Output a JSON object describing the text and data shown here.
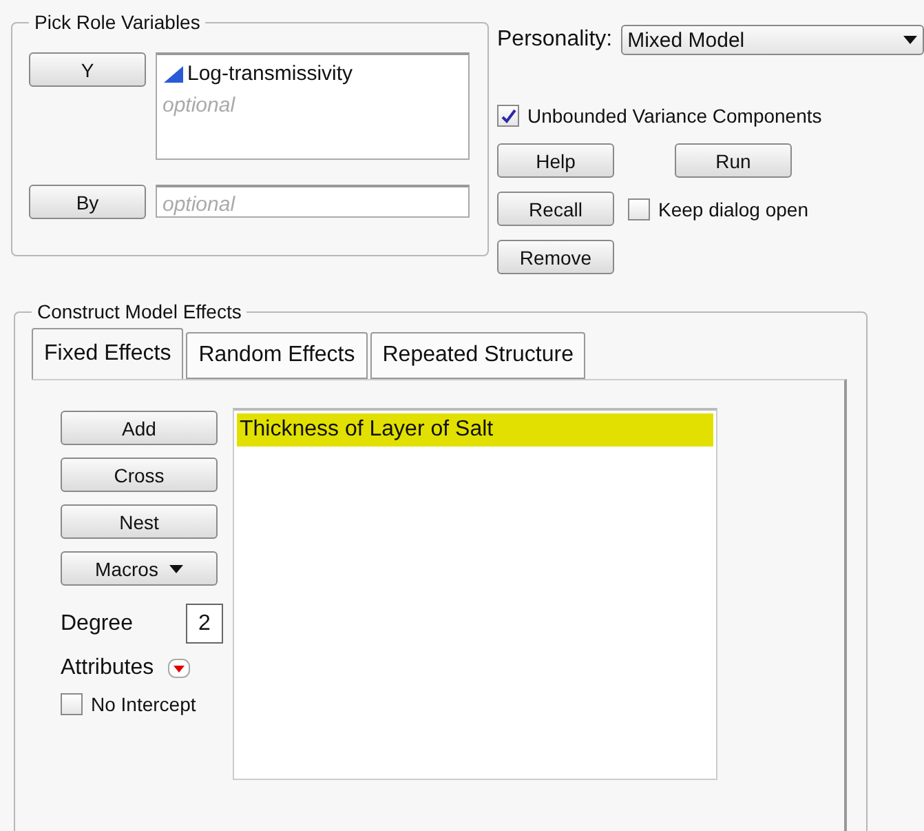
{
  "role_panel": {
    "title": "Pick Role Variables",
    "roles": [
      {
        "button": "Y",
        "items": [
          {
            "kind": "variable",
            "text": "Log-transmissivity"
          },
          {
            "kind": "hint",
            "text": "optional"
          }
        ]
      },
      {
        "button": "By",
        "items": [
          {
            "kind": "hint",
            "text": "optional"
          }
        ]
      }
    ]
  },
  "personality": {
    "label": "Personality:",
    "value": "Mixed Model"
  },
  "unbounded": {
    "label": "Unbounded Variance Components",
    "checked": true
  },
  "help_button": "Help",
  "run_button": "Run",
  "recall_button": "Recall",
  "remove_button": "Remove",
  "keep_open": {
    "label": "Keep dialog open",
    "checked": false
  },
  "effects": {
    "title": "Construct Model Effects",
    "tabs": [
      {
        "label": "Fixed Effects",
        "selected": true
      },
      {
        "label": "Random Effects",
        "selected": false
      },
      {
        "label": "Repeated Structure",
        "selected": false
      }
    ],
    "buttons": [
      "Add",
      "Cross",
      "Nest"
    ],
    "macros": "Macros",
    "degree": {
      "label": "Degree",
      "value": "2"
    },
    "attributes": "Attributes",
    "no_intercept": {
      "label": "No Intercept",
      "checked": false
    },
    "list": [
      {
        "text": "Thickness of Layer of Salt",
        "selected": true
      }
    ]
  }
}
